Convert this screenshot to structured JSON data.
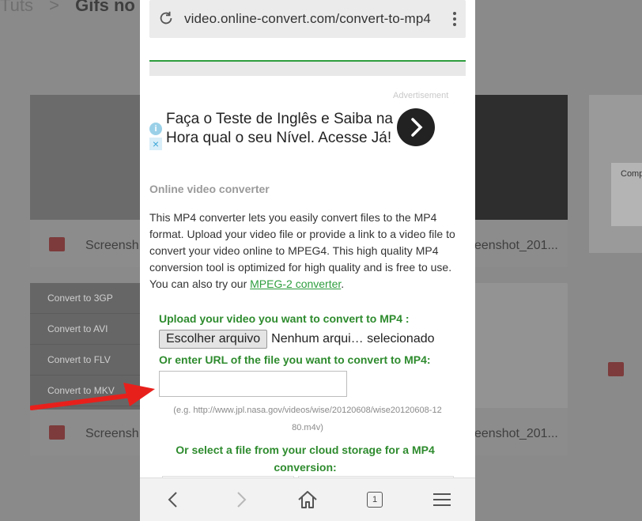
{
  "background": {
    "breadcrumb_prev": "Tuts",
    "breadcrumb_sep": ">",
    "breadcrumb_current": "Gifs no I",
    "card_captions": [
      "Screensh",
      "eenshot_201...",
      "Screensh",
      "eenshot_201..."
    ],
    "menu_items": [
      "Convert to 3GP",
      "Convert to AVI",
      "Convert to FLV",
      "Convert to MKV"
    ],
    "right_card_label": "Comp"
  },
  "browser": {
    "url": "video.online-convert.com/convert-to-mp4",
    "tab_count": "1"
  },
  "ad": {
    "label": "Advertisement",
    "text": "Faça o Teste de Inglês e Saiba na Hora qual o seu Nível. Acesse Já!"
  },
  "page": {
    "section_title": "Online video converter",
    "description": "This MP4 converter lets you easily convert files to the MP4 format. Upload your video file or provide a link to a video file to convert your video online to MPEG4. This high quality MP4 conversion tool is optimized for high quality and is free to use. You can also try our ",
    "description_link": "MPEG-2 converter",
    "description_end": ".",
    "upload_heading": "Upload your video you want to convert to MP4 :",
    "file_button": "Escolher arquivo",
    "file_status": "Nenhum arqui… selecionado",
    "url_heading": "Or enter URL of the file you want to convert to MP4:",
    "url_value": "",
    "example": "(e.g. http://www.jpl.nasa.gov/videos/wise/20120608/wise20120608-12 80.m4v)",
    "cloud_heading": "Or select a file from your cloud storage for a MP4 conversion:"
  },
  "colors": {
    "accent_green": "#2e8b2e",
    "arrow_red": "#e8201c"
  }
}
